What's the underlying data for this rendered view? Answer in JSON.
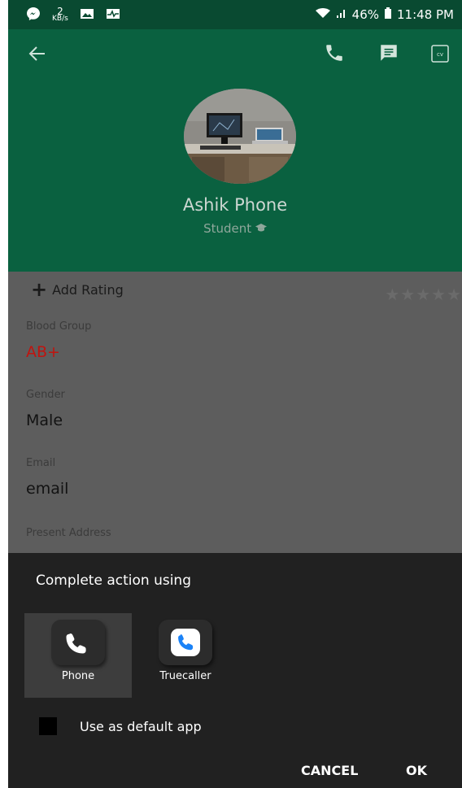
{
  "status_bar": {
    "net_speed_value": "2",
    "net_speed_unit": "KB/s",
    "battery": "46%",
    "time": "11:48 PM"
  },
  "profile": {
    "name": "Ashik Phone",
    "role": "Student"
  },
  "rating": {
    "add_label": "Add Rating",
    "stars": "★★★★★"
  },
  "fields": [
    {
      "label": "Blood Group",
      "value": "AB+"
    },
    {
      "label": "Gender",
      "value": "Male"
    },
    {
      "label": "Email",
      "value": "email"
    },
    {
      "label": "Present Address",
      "value": ""
    }
  ],
  "dialog": {
    "title": "Complete action using",
    "apps": [
      {
        "label": "Phone",
        "icon": "phone-icon",
        "selected": true
      },
      {
        "label": "Truecaller",
        "icon": "truecaller-icon",
        "selected": false
      }
    ],
    "default_label": "Use as default app",
    "cancel": "CANCEL",
    "ok": "OK"
  },
  "colors": {
    "header": "#0a6140",
    "status_bar": "#094a31",
    "blood_group_value": "#c0140f",
    "dialog_bg": "#212121",
    "truecaller_blue": "#1a82f7"
  }
}
